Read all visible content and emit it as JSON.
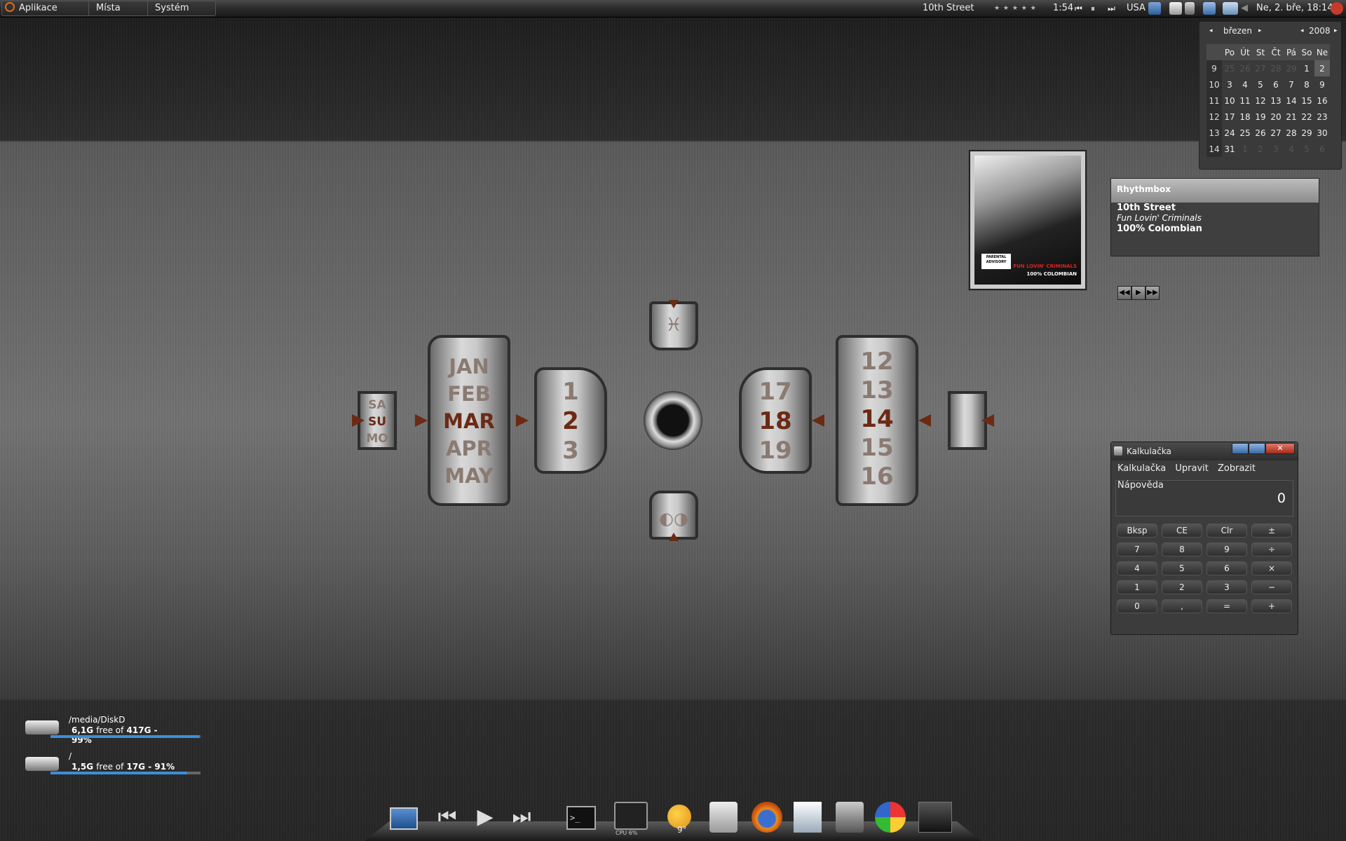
{
  "top_panel": {
    "menus": [
      "Aplikace",
      "Místa",
      "Systém"
    ],
    "now_playing": "10th Street",
    "rating_stars": "★ ★ ★ ★ ★",
    "elapsed": "1:54",
    "keyboard_layout": "USA",
    "clock": "Ne,  2. bře, 18:14"
  },
  "calendar": {
    "month": "březen",
    "year": "2008",
    "weekday_headers": [
      "Po",
      "Út",
      "St",
      "Čt",
      "Pá",
      "So",
      "Ne"
    ],
    "weeks": [
      {
        "week": "9",
        "days": [
          "25",
          "26",
          "27",
          "28",
          "29",
          "1",
          "2"
        ]
      },
      {
        "week": "10",
        "days": [
          "3",
          "4",
          "5",
          "6",
          "7",
          "8",
          "9"
        ]
      },
      {
        "week": "11",
        "days": [
          "10",
          "11",
          "12",
          "13",
          "14",
          "15",
          "16"
        ]
      },
      {
        "week": "12",
        "days": [
          "17",
          "18",
          "19",
          "20",
          "21",
          "22",
          "23"
        ]
      },
      {
        "week": "13",
        "days": [
          "24",
          "25",
          "26",
          "27",
          "28",
          "29",
          "30"
        ]
      },
      {
        "week": "14",
        "days": [
          "31",
          "1",
          "2",
          "3",
          "4",
          "5",
          "6"
        ]
      }
    ]
  },
  "rhythmbox": {
    "app": "Rhythmbox",
    "title": "10th Street",
    "artist": "Fun Lovin' Criminals",
    "album": "100% Colombian",
    "art_text_1": "FUN LOVIN' CRIMINALS",
    "art_text_2": "100% COLOMBIAN",
    "art_advisory": "PARENTAL ADVISORY"
  },
  "clock_gadget": {
    "weekday_prev": "SA",
    "weekday_cur": "SU",
    "weekday_next": "MO",
    "months": [
      "JAN",
      "FEB",
      "MAR",
      "APR",
      "MAY"
    ],
    "day_prev": "1",
    "day_cur": "2",
    "day_next": "3",
    "minute_prev": "17",
    "minute_cur": "18",
    "minute_next": "19",
    "hours": [
      "12",
      "13",
      "14",
      "15",
      "16"
    ],
    "zodiac_symbol": "♓",
    "moon_symbol": "◐◑"
  },
  "calculator": {
    "title": "Kalkulačka",
    "menu": [
      "Kalkulačka",
      "Upravit",
      "Zobrazit",
      "Nápověda"
    ],
    "display": "0",
    "rows": [
      [
        "Bksp",
        "CE",
        "Clr",
        "±"
      ],
      [
        "7",
        "8",
        "9",
        "÷"
      ],
      [
        "4",
        "5",
        "6",
        "×"
      ],
      [
        "1",
        "2",
        "3",
        "−"
      ],
      [
        "0",
        ",",
        "=",
        "+"
      ]
    ]
  },
  "disks": [
    {
      "path": "/media/DiskD",
      "free": "6,1G",
      "free_of": "free of",
      "total": "417G - 99%",
      "fill_fraction": 0.99
    },
    {
      "path": "/",
      "free": "1,5G",
      "free_of": "free of",
      "total": "17G - 91%",
      "fill_fraction": 0.91
    }
  ],
  "dock": {
    "cpu_label": "CPU 6%",
    "weather_temp": "9°"
  },
  "colors": {
    "accent_dark_red": "#6b2a14",
    "disk_bar": "#3b8fd8"
  }
}
